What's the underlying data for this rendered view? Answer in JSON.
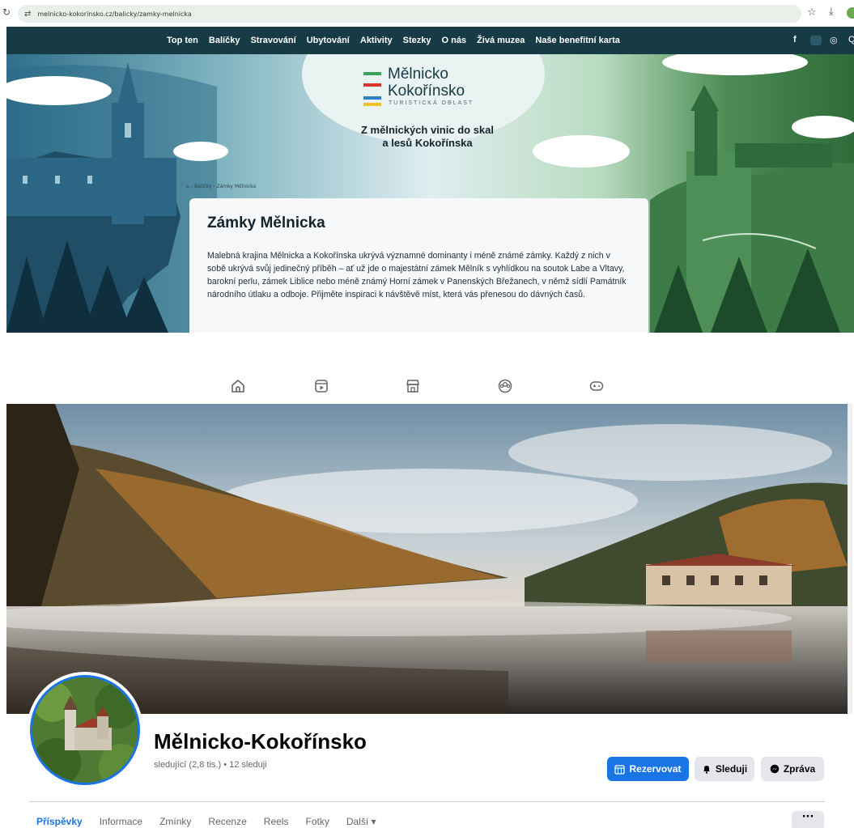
{
  "browser": {
    "url": "melnicko-kokorinsko.cz/balicky/zamky-melnicka"
  },
  "site": {
    "nav": [
      "Top ten",
      "Balíčky",
      "Stravování",
      "Ubytování",
      "Aktivity",
      "Stezky",
      "O nás",
      "Živá muzea",
      "Naše benefitní karta"
    ],
    "social": {
      "facebook": "f",
      "instagram": "◎",
      "search": "Q"
    },
    "logo": {
      "line1": "Mělnicko",
      "line2": "Kokořínsko",
      "line3": "TURISTICKÁ OBLAST"
    },
    "tagline_1": "Z mělnických vinic do skal",
    "tagline_2": "a lesů Kokořínska",
    "breadcrumb": "⌂ › Balíčky › Zámky Mělnicka",
    "card": {
      "title": "Zámky Mělnicka",
      "body": "Malebná krajina Mělnicka a Kokořínska ukrývá významné dominanty i méně známé zámky. Každý z nich v sobě ukrývá svůj jedinečný příběh – ať už jde o majestátní zámek Mělník s vyhlídkou na soutok Labe a Vltavy, barokní perlu, zámek Liblice nebo méně známý Horní zámek v Panenských Břežanech, v němž sídlí Památník národního útlaku a odboje. Přijměte inspiraci k návštěvě míst, která vás přenesou do dávných časů."
    },
    "colors": {
      "nav_bg": "#173b45",
      "accent_green": "#3aa35b",
      "accent_red": "#d9342b",
      "accent_blue": "#2d7fc1",
      "accent_yellow": "#f2c12e"
    }
  },
  "facebook": {
    "top_icons": [
      "home-icon",
      "video-icon",
      "marketplace-icon",
      "groups-icon",
      "gaming-icon"
    ],
    "page_name": "Mělnicko-Kokořínsko",
    "follow_stats": "sledující (2,8 tis.) • 12 sleduji",
    "buttons": {
      "book": "Rezervovat",
      "follow": "Sleduji",
      "message": "Zpráva"
    },
    "tabs": [
      "Příspěvky",
      "Informace",
      "Zmínky",
      "Recenze",
      "Reels",
      "Fotky",
      "Další ▾"
    ],
    "more": "···",
    "colors": {
      "primary": "#1b74e4",
      "secondary_bg": "#e4e6eb"
    }
  }
}
